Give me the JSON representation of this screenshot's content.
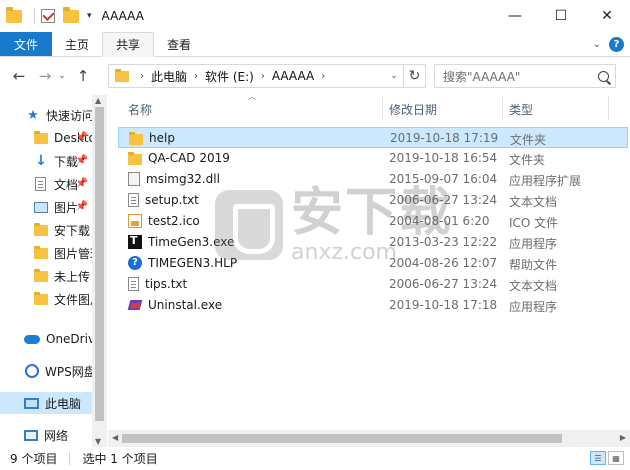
{
  "window": {
    "title": "AAAAA",
    "controls": {
      "minimize": "—",
      "maximize": "☐",
      "close": "✕"
    }
  },
  "ribbon": {
    "tabs": [
      "文件",
      "主页",
      "共享",
      "查看"
    ],
    "active_tab": "共享"
  },
  "address": {
    "crumbs": [
      "此电脑",
      "软件 (E:)",
      "AAAAA"
    ],
    "search_placeholder": "搜索\"AAAAA\""
  },
  "nav": {
    "items": [
      {
        "label": "快速访问",
        "icon": "star-icon",
        "pinned": false
      },
      {
        "label": "Desktop",
        "icon": "folder-icon",
        "pinned": true
      },
      {
        "label": "下载",
        "icon": "download-icon",
        "pinned": true
      },
      {
        "label": "文档",
        "icon": "document-icon",
        "pinned": true
      },
      {
        "label": "图片",
        "icon": "pictures-icon",
        "pinned": true
      },
      {
        "label": "安下载",
        "icon": "folder-icon",
        "pinned": false
      },
      {
        "label": "图片管理",
        "icon": "folder-icon",
        "pinned": false
      },
      {
        "label": "未上传",
        "icon": "folder-icon",
        "pinned": false
      },
      {
        "label": "文件图片",
        "icon": "folder-icon",
        "pinned": false
      },
      {
        "label": "OneDrive",
        "icon": "cloud-icon",
        "pinned": false
      },
      {
        "label": "WPS网盘",
        "icon": "wps-icon",
        "pinned": false
      },
      {
        "label": "此电脑",
        "icon": "computer-icon",
        "pinned": false,
        "selected": true
      },
      {
        "label": "网络",
        "icon": "network-icon",
        "pinned": false
      }
    ]
  },
  "columns": {
    "name": "名称",
    "date": "修改日期",
    "type": "类型"
  },
  "files": [
    {
      "name": "help",
      "date": "2019-10-18 17:19",
      "type": "文件夹",
      "icon": "folder",
      "selected": true
    },
    {
      "name": "QA-CAD 2019",
      "date": "2019-10-18 16:54",
      "type": "文件夹",
      "icon": "folder"
    },
    {
      "name": "msimg32.dll",
      "date": "2015-09-07 16:04",
      "type": "应用程序扩展",
      "icon": "dll"
    },
    {
      "name": "setup.txt",
      "date": "2006-06-27 13:24",
      "type": "文本文档",
      "icon": "txt"
    },
    {
      "name": "test2.ico",
      "date": "2004-08-01 6:20",
      "type": "ICO 文件",
      "icon": "ico"
    },
    {
      "name": "TimeGen3.exe",
      "date": "2013-03-23 12:22",
      "type": "应用程序",
      "icon": "exe1"
    },
    {
      "name": "TIMEGEN3.HLP",
      "date": "2004-08-26 12:07",
      "type": "帮助文件",
      "icon": "hlp"
    },
    {
      "name": "tips.txt",
      "date": "2006-06-27 13:24",
      "type": "文本文档",
      "icon": "txt"
    },
    {
      "name": "Uninstal.exe",
      "date": "2019-10-18 17:18",
      "type": "应用程序",
      "icon": "uninst"
    }
  ],
  "status": {
    "item_count": "9 个项目",
    "selected_count": "选中 1 个项目"
  },
  "watermark": {
    "big": "安下载",
    "small": "anxz.com"
  },
  "colors": {
    "accent": "#1979ca",
    "selection": "#cce8ff",
    "folder": "#f5c242"
  }
}
